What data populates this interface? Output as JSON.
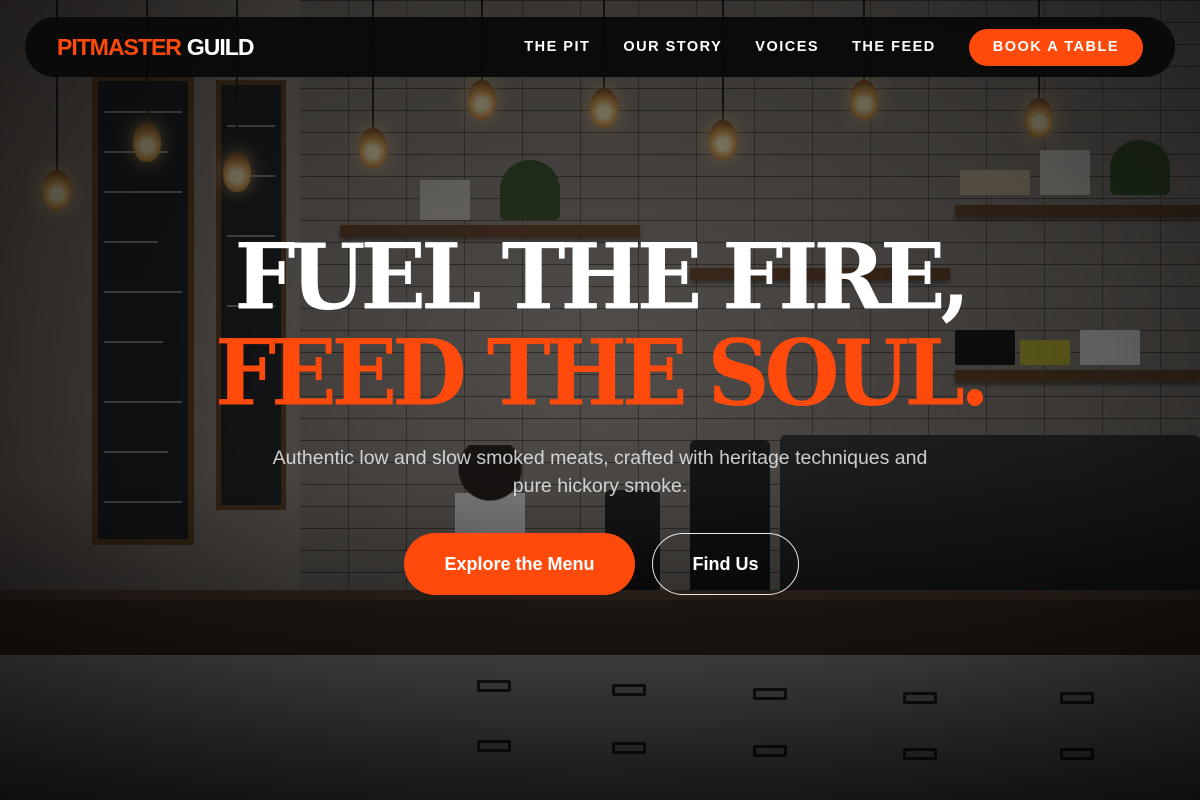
{
  "brand": {
    "primary": "PITMASTER",
    "secondary": "GUILD"
  },
  "nav": {
    "links": [
      {
        "label": "THE PIT"
      },
      {
        "label": "OUR STORY"
      },
      {
        "label": "VOICES"
      },
      {
        "label": "THE FEED"
      }
    ],
    "cta_label": "BOOK A TABLE"
  },
  "hero": {
    "headline_line1": "FUEL THE FIRE,",
    "headline_line2": "FEED THE SOUL.",
    "subtitle": "Authentic low and slow smoked meats, crafted with heritage techniques and pure hickory smoke.",
    "primary_button": "Explore the Menu",
    "secondary_button": "Find Us"
  },
  "colors": {
    "accent": "#ff4a0c",
    "nav_background": "#080808",
    "text": "#ffffff"
  },
  "background": {
    "description_icon": "cafe-interior-photo"
  }
}
